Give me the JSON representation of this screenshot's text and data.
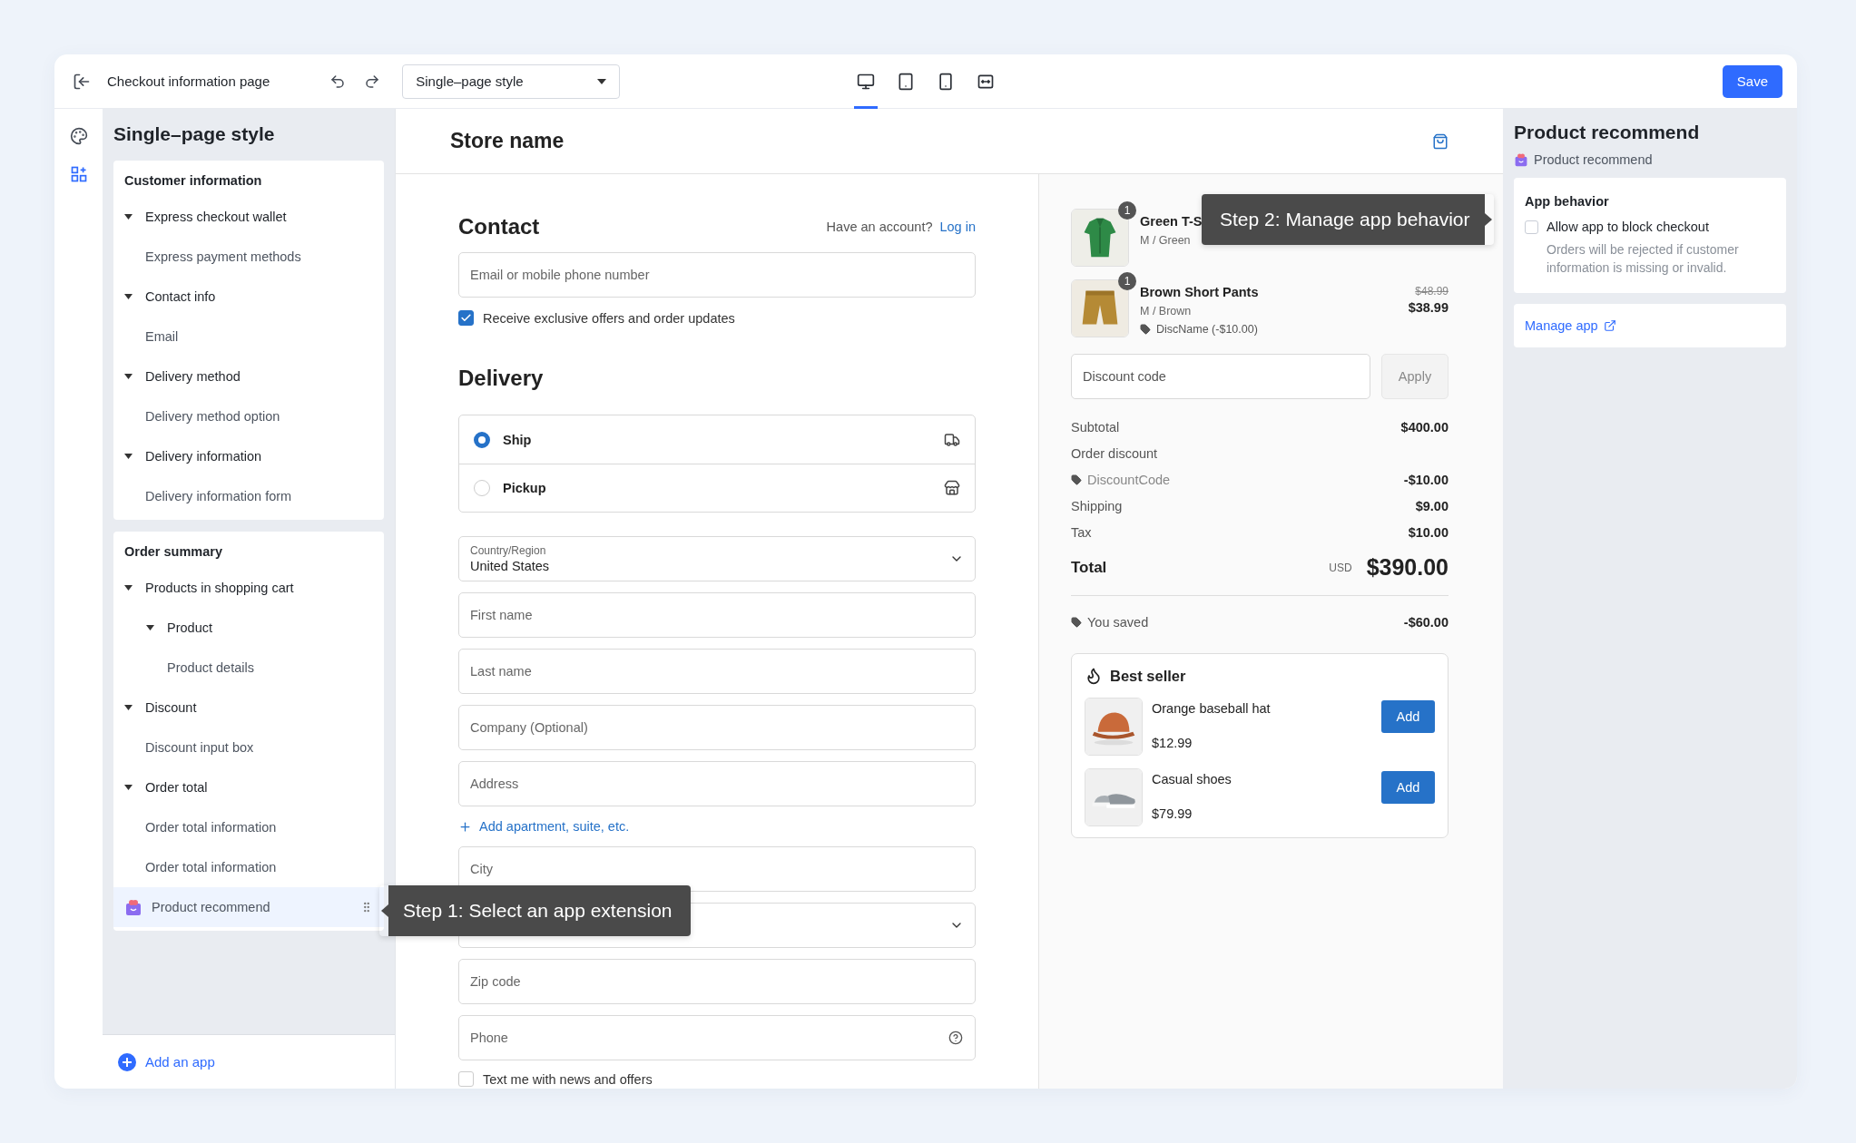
{
  "toolbar": {
    "title": "Checkout information page",
    "style_select": "Single–page style",
    "devices": [
      {
        "kind": "desktop",
        "selected": true
      },
      {
        "kind": "tablet",
        "selected": false
      },
      {
        "kind": "mobile",
        "selected": false
      },
      {
        "kind": "fullwidth",
        "selected": false
      }
    ],
    "save": "Save"
  },
  "rail": [
    {
      "kind": "palette",
      "selected": false
    },
    {
      "kind": "blocks",
      "selected": true
    }
  ],
  "sidebar": {
    "title": "Single–page style",
    "sections": [
      {
        "title": "Customer information",
        "items": [
          {
            "label": "Express checkout wallet",
            "expanded": true,
            "children": [
              {
                "label": "Express payment methods"
              }
            ]
          },
          {
            "label": "Contact info",
            "expanded": true,
            "children": [
              {
                "label": "Email"
              }
            ]
          },
          {
            "label": "Delivery method",
            "expanded": true,
            "children": [
              {
                "label": "Delivery method option"
              }
            ]
          },
          {
            "label": "Delivery information",
            "expanded": true,
            "children": [
              {
                "label": "Delivery information form"
              }
            ]
          }
        ]
      },
      {
        "title": "Order summary",
        "items": [
          {
            "label": "Products in shopping cart",
            "expanded": true,
            "children": [
              {
                "label": "Product",
                "expanded": true,
                "children": [
                  {
                    "label": "Product details"
                  }
                ]
              }
            ]
          },
          {
            "label": "Discount",
            "expanded": true,
            "children": [
              {
                "label": "Discount input box"
              }
            ]
          },
          {
            "label": "Order total",
            "expanded": true,
            "children": [
              {
                "label": "Order total information"
              },
              {
                "label": "Order total information"
              }
            ]
          }
        ],
        "app": {
          "label": "Product recommend",
          "selected": true
        }
      }
    ],
    "add_app": "Add an app"
  },
  "tooltips": [
    {
      "kind": "left",
      "text": "Step 1: Select an app extension"
    },
    {
      "kind": "right",
      "text": "Step 2: Manage app behavior"
    }
  ],
  "preview": {
    "store_name": "Store name",
    "contact": {
      "heading": "Contact",
      "account_prompt": "Have an account?",
      "login_link": "Log in",
      "email_placeholder": "Email or mobile phone number",
      "offers": {
        "label": "Receive exclusive offers and order updates",
        "checked": true
      }
    },
    "delivery": {
      "heading": "Delivery",
      "options": [
        {
          "kind": "ship",
          "label": "Ship",
          "selected": true
        },
        {
          "kind": "pickup",
          "label": "Pickup",
          "selected": false
        }
      ],
      "fields": [
        {
          "kind": "select",
          "label": "Country/Region",
          "value": "United States"
        },
        {
          "kind": "input",
          "placeholder": "First name"
        },
        {
          "kind": "input",
          "placeholder": "Last name"
        },
        {
          "kind": "input",
          "placeholder": "Company (Optional)"
        },
        {
          "kind": "input",
          "placeholder": "Address"
        },
        {
          "kind": "link",
          "label": "Add apartment, suite, etc."
        },
        {
          "kind": "input",
          "placeholder": "City"
        },
        {
          "kind": "select"
        },
        {
          "kind": "input",
          "placeholder": "Zip code"
        },
        {
          "kind": "help",
          "placeholder": "Phone"
        }
      ],
      "sms": {
        "label": "Text me with news and offers",
        "checked": false
      }
    },
    "summary": {
      "items": [
        {
          "name": "Green T-S",
          "variant": "M / Green",
          "quantity": "1"
        },
        {
          "name": "Brown Short Pants",
          "variant": "M / Brown",
          "quantity": "1",
          "discount": "DiscName (-$10.00)",
          "original_price": "$48.99",
          "price": "$38.99"
        }
      ],
      "discount_placeholder": "Discount code",
      "apply": "Apply",
      "rows": [
        {
          "kind": "plain",
          "label": "Subtotal",
          "value": "$400.00"
        },
        {
          "kind": "plain",
          "label": "Order discount"
        },
        {
          "kind": "code",
          "label": "DiscountCode",
          "value": "-$10.00"
        },
        {
          "kind": "plain",
          "label": "Shipping",
          "value": "$9.00"
        },
        {
          "kind": "plain",
          "label": "Tax",
          "value": "$10.00"
        }
      ],
      "total": {
        "label": "Total",
        "currency": "USD",
        "value": "$390.00"
      },
      "saved": {
        "label": "You saved",
        "value": "-$60.00"
      },
      "best_seller": {
        "title": "Best seller",
        "products": [
          {
            "name": "Orange baseball hat",
            "price": "$12.99",
            "button": "Add"
          },
          {
            "name": "Casual shoes",
            "price": "$79.99",
            "button": "Add"
          }
        ]
      }
    }
  },
  "panel": {
    "title": "Product recommend",
    "app_name": "Product recommend",
    "behavior": {
      "heading": "App behavior",
      "option": {
        "label": "Allow app to block checkout",
        "checked": false
      },
      "description": "Orders will be rejected if customer information is missing or invalid."
    },
    "manage_link": "Manage app"
  }
}
